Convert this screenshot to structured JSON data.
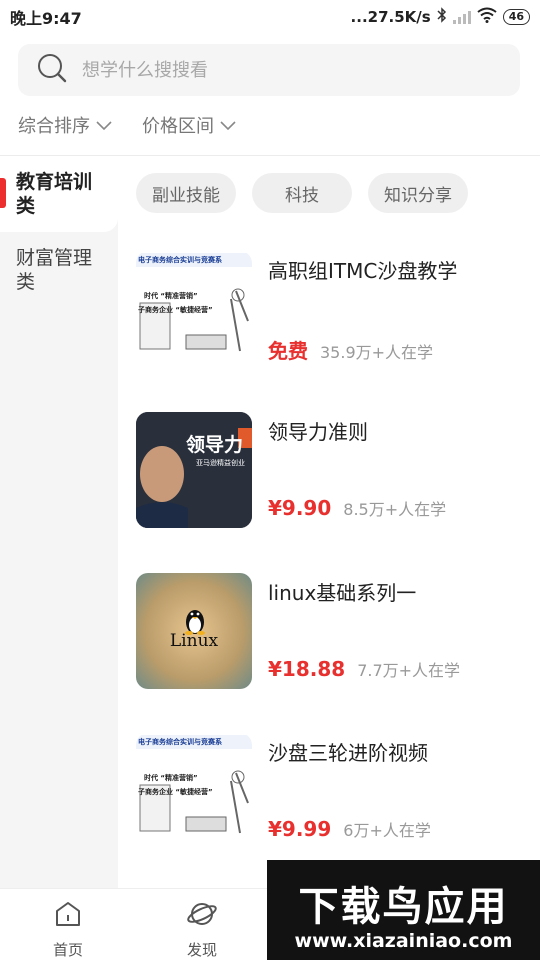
{
  "status_bar": {
    "time": "晚上9:47",
    "network_speed": "...27.5K/s",
    "battery": "46"
  },
  "search": {
    "placeholder": "想学什么搜搜看"
  },
  "filters": [
    {
      "label": "综合排序"
    },
    {
      "label": "价格区间"
    }
  ],
  "sidebar": {
    "items": [
      {
        "label": "教育培训类",
        "active": true
      },
      {
        "label": "财富管理类",
        "active": false
      }
    ]
  },
  "tags": [
    {
      "label": "副业技能"
    },
    {
      "label": "科技"
    },
    {
      "label": "知识分享"
    }
  ],
  "courses": [
    {
      "title": "高职组ITMC沙盘教学",
      "price": "免费",
      "learners": "35.9万+人在学",
      "thumb_caption": "电子商务综合实训与竞赛系",
      "thumb_line1": "时代 “精准营销”",
      "thumb_line2": "子商务企业 “敏捷经营”"
    },
    {
      "title": "领导力准则",
      "price": "¥9.90",
      "learners": "8.5万+人在学",
      "thumb_caption": "领导力",
      "thumb_sub": "亚马逊精益创业"
    },
    {
      "title": "linux基础系列一",
      "price": "¥18.88",
      "learners": "7.7万+人在学",
      "thumb_caption": "Linux"
    },
    {
      "title": "沙盘三轮进阶视频",
      "price": "¥9.99",
      "learners": "6万+人在学",
      "thumb_caption": "电子商务综合实训与竞赛系",
      "thumb_line1": "时代 “精准营销”",
      "thumb_line2": "子商务企业 “敏捷经营”"
    }
  ],
  "bottom_nav": [
    {
      "label": "首页",
      "icon": "home-icon"
    },
    {
      "label": "发现",
      "icon": "planet-icon"
    }
  ],
  "watermark": {
    "logo": "下载鸟应用",
    "url": "www.xiazainiao.com"
  },
  "colors": {
    "accent": "#e8302f",
    "sidebar_bg": "#f5f5f6"
  }
}
